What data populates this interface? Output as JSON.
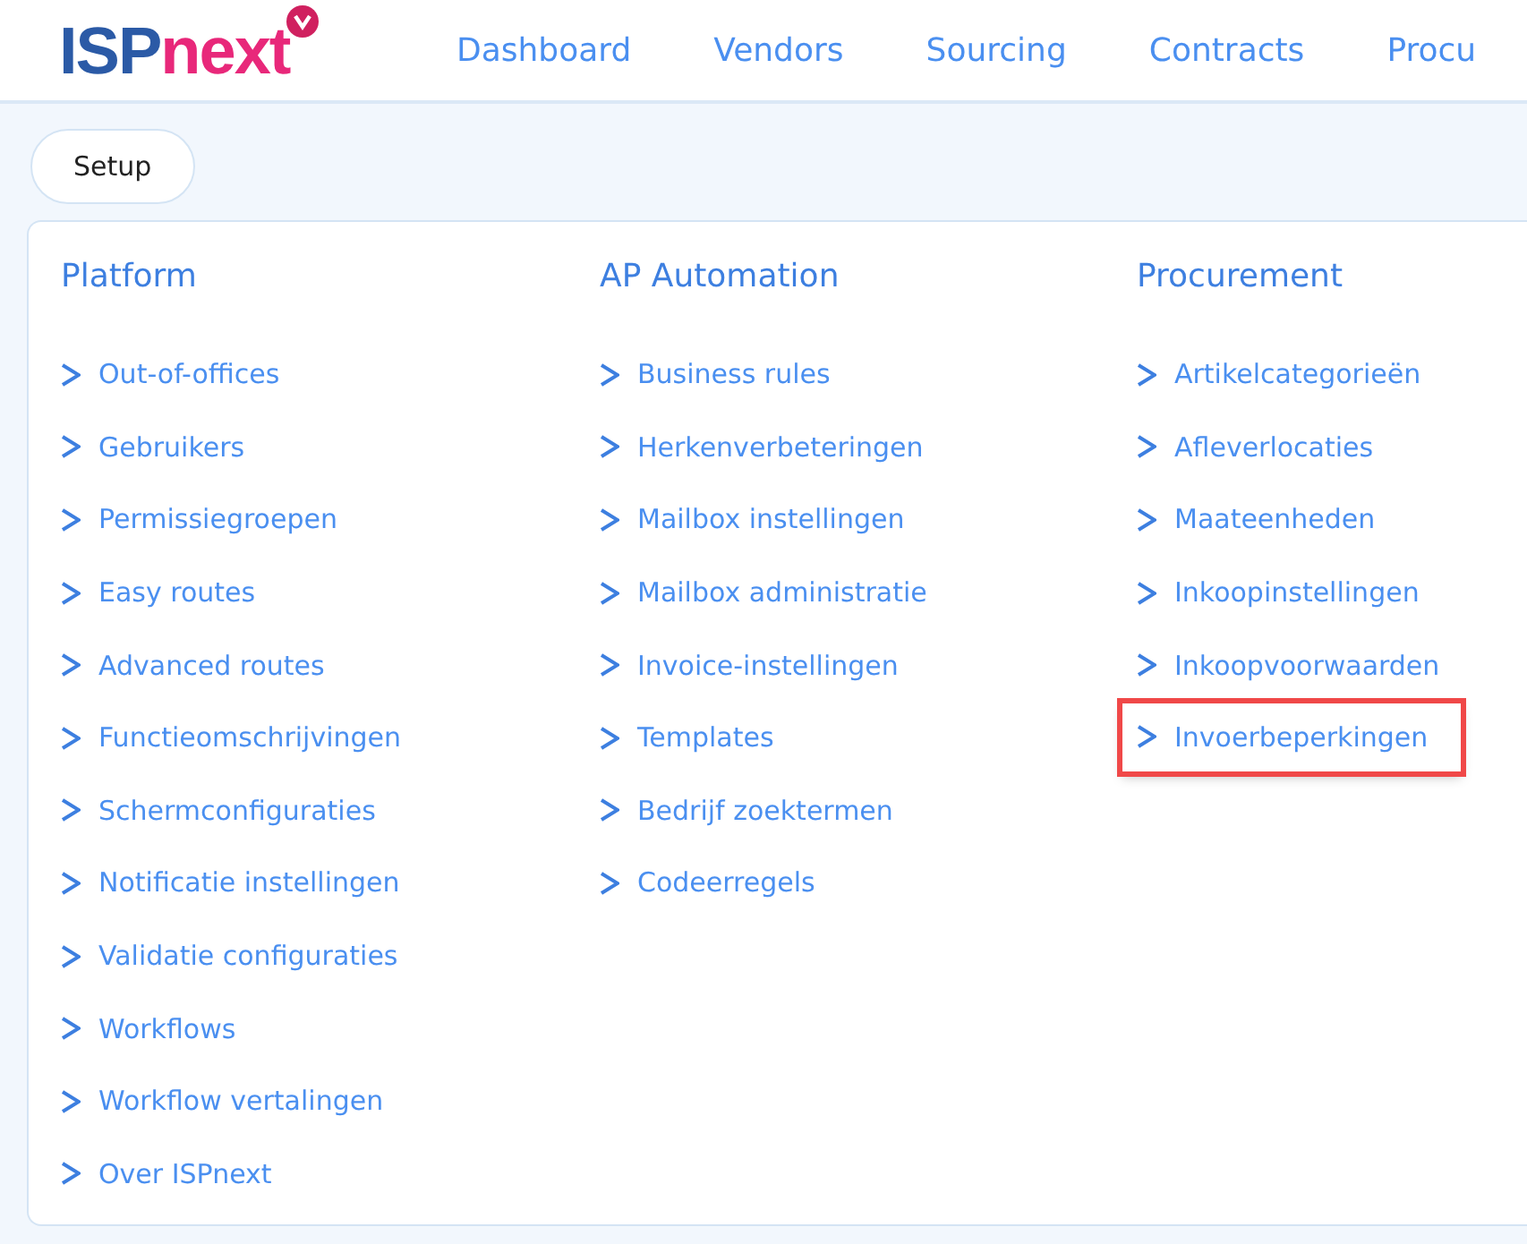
{
  "logo": {
    "part_1": "ISP",
    "part_2": "next"
  },
  "nav": [
    "Dashboard",
    "Vendors",
    "Sourcing",
    "Contracts",
    "Procu"
  ],
  "setup_button": "Setup",
  "columns": [
    {
      "title": "Platform",
      "items": [
        {
          "label": "Out-of-offices",
          "highlighted": false
        },
        {
          "label": "Gebruikers",
          "highlighted": false
        },
        {
          "label": "Permissiegroepen",
          "highlighted": false
        },
        {
          "label": "Easy routes",
          "highlighted": false
        },
        {
          "label": "Advanced routes",
          "highlighted": false
        },
        {
          "label": "Functieomschrijvingen",
          "highlighted": false
        },
        {
          "label": "Schermconfiguraties",
          "highlighted": false
        },
        {
          "label": "Notificatie instellingen",
          "highlighted": false
        },
        {
          "label": "Validatie configuraties",
          "highlighted": false
        },
        {
          "label": "Workflows",
          "highlighted": false
        },
        {
          "label": "Workflow vertalingen",
          "highlighted": false
        },
        {
          "label": "Over ISPnext",
          "highlighted": false
        }
      ]
    },
    {
      "title": "AP Automation",
      "items": [
        {
          "label": "Business rules",
          "highlighted": false
        },
        {
          "label": "Herkenverbeteringen",
          "highlighted": false
        },
        {
          "label": "Mailbox instellingen",
          "highlighted": false
        },
        {
          "label": "Mailbox administratie",
          "highlighted": false
        },
        {
          "label": "Invoice-instellingen",
          "highlighted": false
        },
        {
          "label": "Templates",
          "highlighted": false
        },
        {
          "label": "Bedrijf zoektermen",
          "highlighted": false
        },
        {
          "label": "Codeerregels",
          "highlighted": false
        }
      ]
    },
    {
      "title": "Procurement",
      "items": [
        {
          "label": "Artikelcategorieën",
          "highlighted": false
        },
        {
          "label": "Afleverlocaties",
          "highlighted": false
        },
        {
          "label": "Maateenheden",
          "highlighted": false
        },
        {
          "label": "Inkoopinstellingen",
          "highlighted": false
        },
        {
          "label": "Inkoopvoorwaarden",
          "highlighted": false
        },
        {
          "label": "Invoerbeperkingen",
          "highlighted": true
        }
      ]
    }
  ]
}
